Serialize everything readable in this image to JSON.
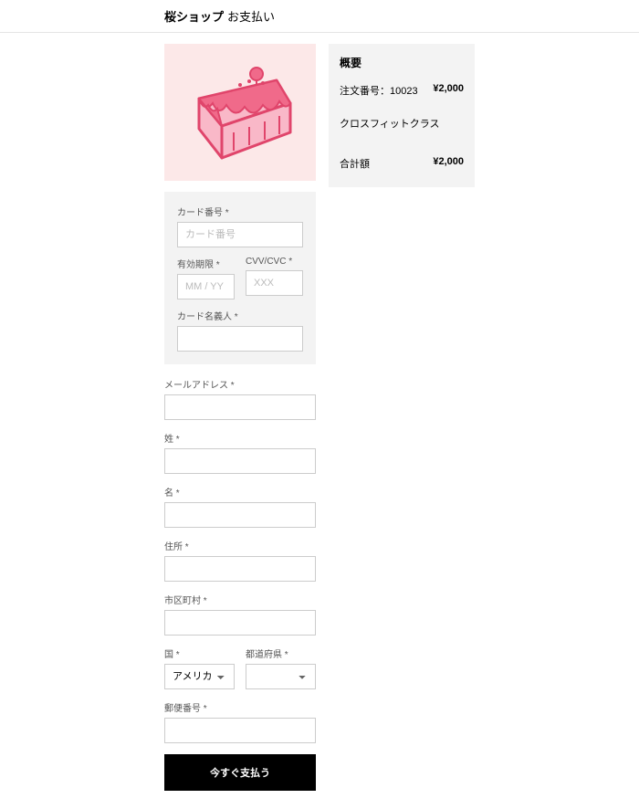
{
  "header": {
    "shop_name": "桜ショップ",
    "page_title": "お支払い"
  },
  "summary": {
    "title": "概要",
    "order_label": "注文番号：10023",
    "order_price": "¥2,000",
    "item_name": "クロスフィットクラス",
    "total_label": "合計額",
    "total_value": "¥2,000"
  },
  "card": {
    "number_label": "カード番号",
    "number_placeholder": "カード番号",
    "expiry_label": "有効期限",
    "expiry_placeholder": "MM / YY",
    "cvv_label": "CVV/CVC",
    "cvv_placeholder": "XXX",
    "name_label": "カード名義人"
  },
  "form": {
    "email_label": "メールアドレス",
    "lastname_label": "姓",
    "firstname_label": "名",
    "address_label": "住所",
    "city_label": "市区町村",
    "country_label": "国",
    "country_value": "アメリカ合衆国",
    "state_label": "都道府県",
    "postal_label": "郵便番号"
  },
  "button": {
    "pay": "今すぐ支払う"
  }
}
